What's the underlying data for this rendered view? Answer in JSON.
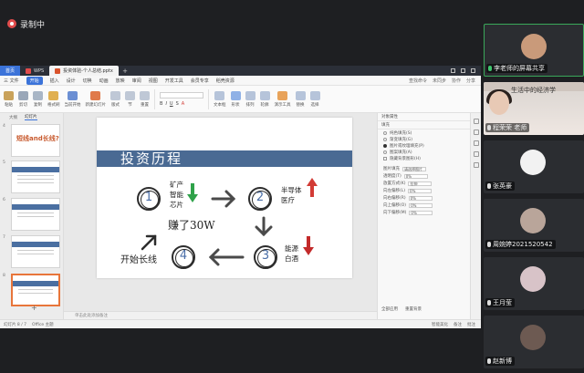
{
  "recording": {
    "label": "录制中"
  },
  "wps": {
    "home_tab": "首页",
    "wps_tab": "WPS",
    "doc_tab": "投资体验-个人总结.pptx",
    "menu": [
      "三 文件",
      "开始",
      "插入",
      "设计",
      "切换",
      "动画",
      "放映",
      "审阅",
      "视图",
      "开发工具",
      "会员专享",
      "稻壳资源"
    ],
    "menu_active": "开始",
    "menu_right": [
      "查找命令",
      "未同步",
      "协作",
      "分享"
    ],
    "ribbon": [
      "粘贴",
      "剪切",
      "复制",
      "格式刷",
      "当前开始",
      "新建幻灯片",
      "版式",
      "节",
      "重置"
    ],
    "ribbon_right": [
      "文本框",
      "形状",
      "排列",
      "轮廓",
      "演示工具",
      "替换",
      "选择"
    ],
    "thumb_tabs": [
      "大纲",
      "幻灯片"
    ],
    "slide_numbers": [
      "4",
      "5",
      "6",
      "7",
      "8"
    ],
    "thumb_title": "短线and长线?",
    "notes_placeholder": "单击此处添加备注",
    "status_left": [
      "幻灯片 8 / 7",
      "Office 主题"
    ],
    "status_right": [
      "智能美化",
      "备注",
      "批注"
    ]
  },
  "slide": {
    "title": "投资历程",
    "step1_num": "1",
    "step1_items": [
      "矿产",
      "智能",
      "芯片"
    ],
    "step2_num": "2",
    "step2_items": [
      "半导体",
      "医疗"
    ],
    "step3_num": "3",
    "step3_items": [
      "能源",
      "白酒"
    ],
    "step4_num": "4",
    "step4_label": "开始长线",
    "result": "赚了30W"
  },
  "panel": {
    "header": "对象属性",
    "section": "填充",
    "options": [
      "纯色填充(S)",
      "渐变填充(G)",
      "图片或纹理填充(P)",
      "图案填充(A)",
      "隐藏背景图形(H)"
    ],
    "selected_option": 2,
    "fields": [
      {
        "label": "图片填充",
        "value": "请选择图片"
      },
      {
        "label": "透明度(T)",
        "value": "0%"
      },
      {
        "label": "放置方式(K)",
        "value": "拉伸"
      },
      {
        "label": "向左偏移(L)",
        "value": "0%"
      },
      {
        "label": "向右偏移(R)",
        "value": "0%"
      },
      {
        "label": "向上偏移(O)",
        "value": "0%"
      },
      {
        "label": "向下偏移(M)",
        "value": "0%"
      }
    ],
    "footer": [
      "全部应用",
      "重置背景"
    ]
  },
  "participants": [
    {
      "name": "李老师的屏幕共享",
      "mic": true,
      "active": true,
      "avatar_color": "#c99a7a"
    },
    {
      "name": "程荣荣 老师",
      "mic": false,
      "active": false,
      "video": true,
      "video_text": "生活中的经济学"
    },
    {
      "name": "张英豪",
      "mic": false,
      "active": false,
      "avatar_color": "#f2f2f2"
    },
    {
      "name": "周婉婷2021520542",
      "mic": false,
      "active": false,
      "avatar_color": "#b9a59a"
    },
    {
      "name": "王月莹",
      "mic": false,
      "active": false,
      "avatar_color": "#d8c3c8"
    },
    {
      "name": "赵新博",
      "mic": false,
      "active": false,
      "avatar_color": "#6d5a52"
    }
  ],
  "colors": {
    "accent": "#3b73d9",
    "band": "#4a6a93",
    "arrow_dark": "#4a4a4a",
    "up_red": "#d23b35",
    "down_green": "#2fa24a",
    "down_red": "#c32a2a"
  }
}
